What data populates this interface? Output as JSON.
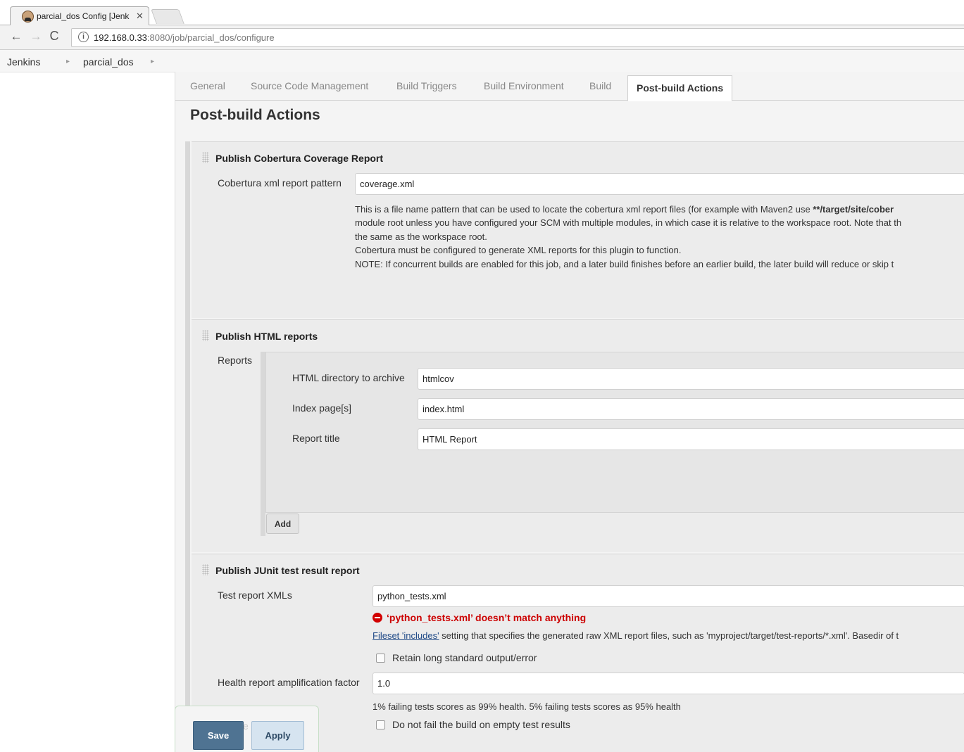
{
  "browser": {
    "tab_title": "parcial_dos Config [Jenki",
    "tab_close": "✕",
    "url_host": "192.168.0.33",
    "url_rest": ":8080/job/parcial_dos/configure",
    "info_glyph": "i",
    "back_glyph": "←",
    "forward_glyph": "→",
    "reload_glyph": "C"
  },
  "breadcrumbs": {
    "items": [
      "Jenkins",
      "parcial_dos"
    ],
    "separator": "▸"
  },
  "config_tabs": {
    "items": [
      "General",
      "Source Code Management",
      "Build Triggers",
      "Build Environment",
      "Build",
      "Post-build Actions"
    ],
    "active": "Post-build Actions"
  },
  "section_heading": "Post-build Actions",
  "cobertura": {
    "title": "Publish Cobertura Coverage Report",
    "pattern_label": "Cobertura xml report pattern",
    "pattern_value": "coverage.xml",
    "help_line1_pre": "This is a file name pattern that can be used to locate the cobertura xml report files (for example with Maven2 use ",
    "help_line1_bold": "**/target/site/cober",
    "help_line2": "module root unless you have configured your SCM with multiple modules, in which case it is relative to the workspace root. Note that th",
    "help_line3": "the same as the workspace root.",
    "help_line4": "Cobertura must be configured to generate XML reports for this plugin to function.",
    "help_line5": "NOTE: If concurrent builds are enabled for this job, and a later build finishes before an earlier build, the later build will reduce or skip t"
  },
  "html_reports": {
    "title": "Publish HTML reports",
    "reports_label": "Reports",
    "dir_label": "HTML directory to archive",
    "dir_value": "htmlcov",
    "index_label": "Index page[s]",
    "index_value": "index.html",
    "report_title_label": "Report title",
    "report_title_value": "HTML Report",
    "add_label": "Add"
  },
  "junit": {
    "title": "Publish JUnit test result report",
    "xmls_label": "Test report XMLs",
    "xmls_value": "python_tests.xml",
    "error_text": "‘python_tests.xml’ doesn’t match anything",
    "help_link": "Fileset 'includes'",
    "help_rest": " setting that specifies the generated raw XML report files, such as 'myproject/target/test-reports/*.xml'. Basedir of t",
    "retain_label": "Retain long standard output/error",
    "retain_checked": false,
    "health_label": "Health report amplification factor",
    "health_value": "1.0",
    "health_help": "1% failing tests scores as 99% health. 5% failing tests scores as 95% health",
    "no_fail_label": "Do not fail the build on empty test results",
    "no_fail_checked": false
  },
  "actions": {
    "save_label": "Save",
    "apply_label": "Apply",
    "faded_label": "e"
  }
}
